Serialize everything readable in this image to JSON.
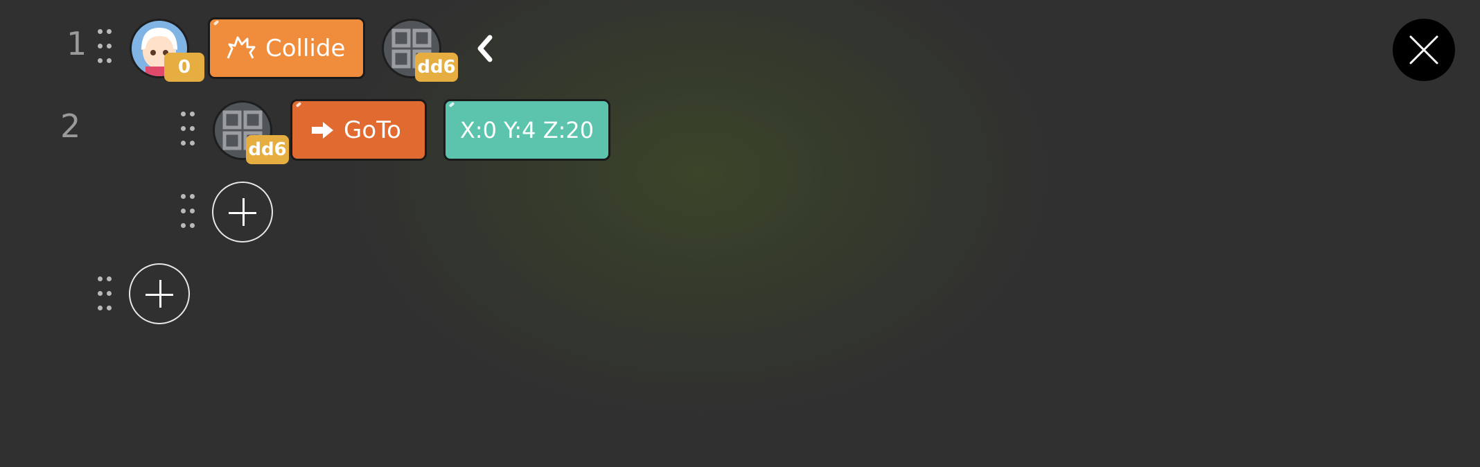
{
  "rows": [
    {
      "number": "1",
      "subject_badge": "0",
      "event_label": "Collide",
      "target_badge": "dd6"
    },
    {
      "number": "2",
      "object_badge": "dd6",
      "action_label": "GoTo",
      "param_label": "X:0 Y:4 Z:20"
    }
  ],
  "icons": {
    "close": "close-icon",
    "collapse": "chevron-left-icon",
    "add": "plus-icon",
    "drag": "drag-handle-icon"
  },
  "colors": {
    "background": "#303030",
    "event_tile": "#f08d3c",
    "action_tile": "#e06a30",
    "param_tile": "#5cc4ad",
    "badge": "#e6ae40"
  }
}
